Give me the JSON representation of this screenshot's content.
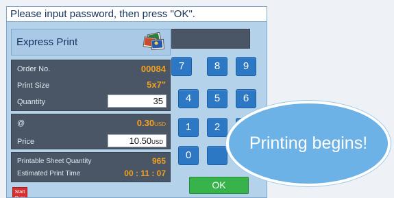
{
  "prompt": {
    "text": "Please input password, then press \"OK\"."
  },
  "header": {
    "title": "Express Print",
    "icon": "photo-prints-icon"
  },
  "order": {
    "order_no_label": "Order No.",
    "order_no_value": "00084",
    "print_size_label": "Print Size",
    "print_size_value": "5x7\"",
    "quantity_label": "Quantity",
    "quantity_value": "35"
  },
  "pricing": {
    "unit_label": "@",
    "unit_price": "0.30",
    "unit_price_currency": "USD",
    "price_label": "Price",
    "price_value": "10.50",
    "price_currency": "USD"
  },
  "sheet": {
    "printable_label": "Printable Sheet Quantity",
    "printable_value": "965",
    "time_label": "Estimated Print Time",
    "time_value": "00 : 11 : 07"
  },
  "buttons": {
    "start_over": "Start Over",
    "ok": "OK"
  },
  "keypad": [
    "7",
    "8",
    "9",
    "4",
    "5",
    "6",
    "1",
    "2",
    "0"
  ],
  "callout": {
    "text": "Printing begins!"
  },
  "colors": {
    "panel_bg": "#4a5566",
    "value_orange": "#f0a21c",
    "key_blue": "#2d78c5",
    "ok_green": "#38b24a",
    "start_red": "#d83030",
    "bubble_blue": "#6db2e6"
  }
}
